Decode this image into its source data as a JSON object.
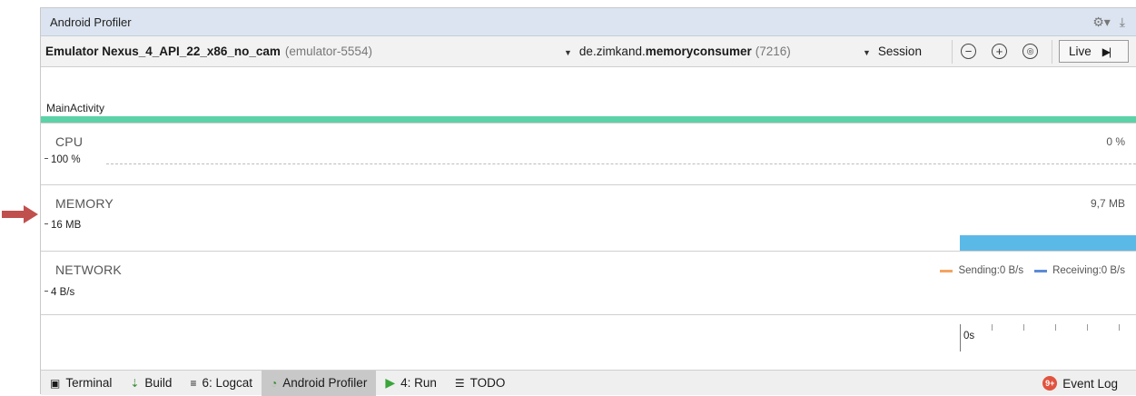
{
  "window": {
    "title": "Android Profiler"
  },
  "toolbar": {
    "device_name": "Emulator Nexus_4_API_22_x86_no_cam",
    "device_id": "(emulator-5554)",
    "process_prefix": "de.zimkand.",
    "process_name": "memoryconsumer",
    "process_pid": "(7216)",
    "session_label": "Session",
    "live_label": "Live"
  },
  "events": {
    "activity": "MainActivity"
  },
  "cpu": {
    "title": "CPU",
    "value": "0 %",
    "axis_max": "100 %"
  },
  "memory": {
    "title": "MEMORY",
    "value": "9,7 MB",
    "axis_max": "16 MB"
  },
  "network": {
    "title": "NETWORK",
    "axis_max": "4 B/s",
    "legend": [
      {
        "label": "Sending:0 B/s",
        "color": "#f4a460"
      },
      {
        "label": "Receiving:0 B/s",
        "color": "#5b8bd6"
      }
    ]
  },
  "timeline": {
    "zero_label": "0s"
  },
  "bottombar": {
    "items": [
      {
        "label": "Terminal",
        "icon": "terminal-icon"
      },
      {
        "label": "Build",
        "icon": "build-icon"
      },
      {
        "label": "6: Logcat",
        "icon": "logcat-icon"
      },
      {
        "label": "Android Profiler",
        "icon": "profiler-icon"
      },
      {
        "label": "4: Run",
        "icon": "run-icon"
      },
      {
        "label": "TODO",
        "icon": "todo-icon"
      }
    ],
    "event_log": "Event Log",
    "event_badge": "9+"
  },
  "colors": {
    "activity_bar": "#5cd2a8",
    "memory_fill": "#5bb9e8",
    "annotation_arrow": "#c0504d"
  }
}
